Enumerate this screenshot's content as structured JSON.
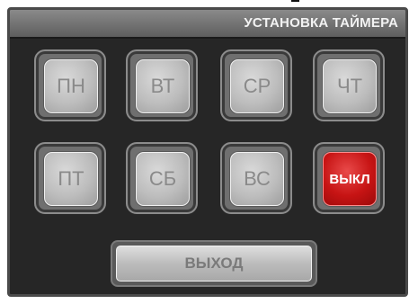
{
  "title": "УСТАНОВКА ТАЙМЕРА",
  "days": [
    {
      "key": "mon",
      "label": "ПН",
      "active": false
    },
    {
      "key": "tue",
      "label": "ВТ",
      "active": false
    },
    {
      "key": "wed",
      "label": "СР",
      "active": false
    },
    {
      "key": "thu",
      "label": "ЧТ",
      "active": false
    },
    {
      "key": "fri",
      "label": "ПТ",
      "active": false
    },
    {
      "key": "sat",
      "label": "СБ",
      "active": false
    },
    {
      "key": "sun",
      "label": "ВС",
      "active": false
    }
  ],
  "off_button": {
    "label": "ВЫКЛ",
    "active": true
  },
  "exit_button": {
    "label": "ВЫХОД"
  },
  "colors": {
    "panel": "#262626",
    "button_inactive": "#bdbdbd",
    "button_active": "#c71414",
    "label_inactive": "#8a8a8a",
    "label_active": "#ffffff"
  }
}
